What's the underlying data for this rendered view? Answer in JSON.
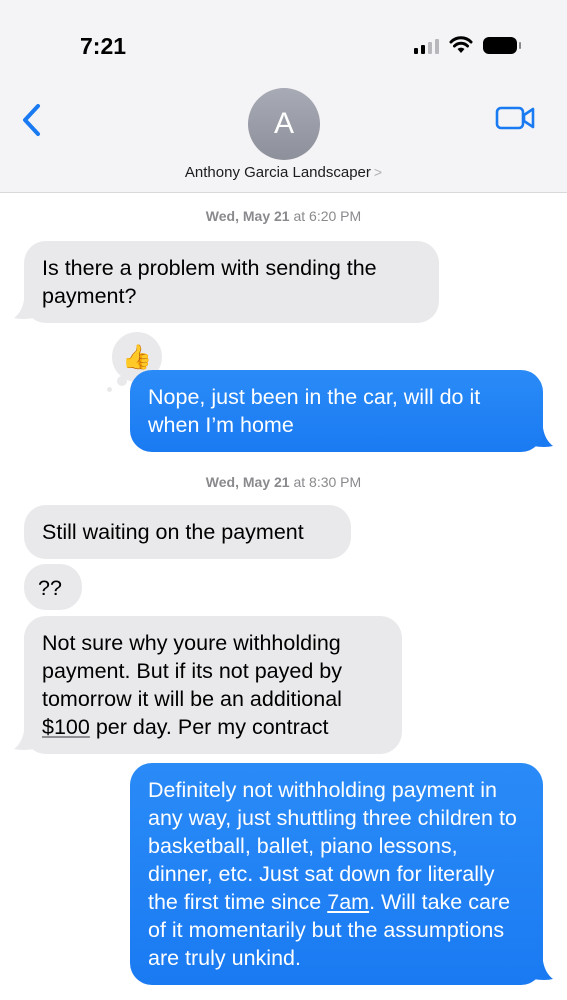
{
  "status_bar": {
    "time": "7:21"
  },
  "header": {
    "avatar_initial": "A",
    "contact_name": "Anthony Garcia Landscaper",
    "chevron": ">"
  },
  "messages": [
    {
      "kind": "timestamp",
      "day": "Wed, May 21",
      "at": "at",
      "time": "6:20 PM"
    },
    {
      "kind": "incoming",
      "text": "Is there a problem with sending the payment?"
    },
    {
      "kind": "reaction",
      "emoji": "👍"
    },
    {
      "kind": "outgoing",
      "text": "Nope, just been in the car, will do it when I’m home"
    },
    {
      "kind": "timestamp",
      "day": "Wed, May 21",
      "at": "at",
      "time": "8:30 PM"
    },
    {
      "kind": "incoming",
      "text": "Still waiting on the payment"
    },
    {
      "kind": "incoming",
      "text": "??"
    },
    {
      "kind": "incoming",
      "text_before": "Not sure why youre withholding payment. But if its not payed by tomorrow it will be an additional ",
      "link": "$100",
      "text_after": " per day. Per my contract"
    },
    {
      "kind": "outgoing",
      "text_before": "Definitely not withholding payment in any way, just shuttling three children to basketball, ballet, piano lessons, dinner, etc. Just sat down for literally the first time since ",
      "link": "7am",
      "text_after": ". Will take care of it momentarily but the assumptions are truly unkind."
    }
  ],
  "colors": {
    "outgoing_bubble": "#1a7af2",
    "incoming_bubble": "#e9e9eb",
    "accent": "#1a7af2"
  }
}
